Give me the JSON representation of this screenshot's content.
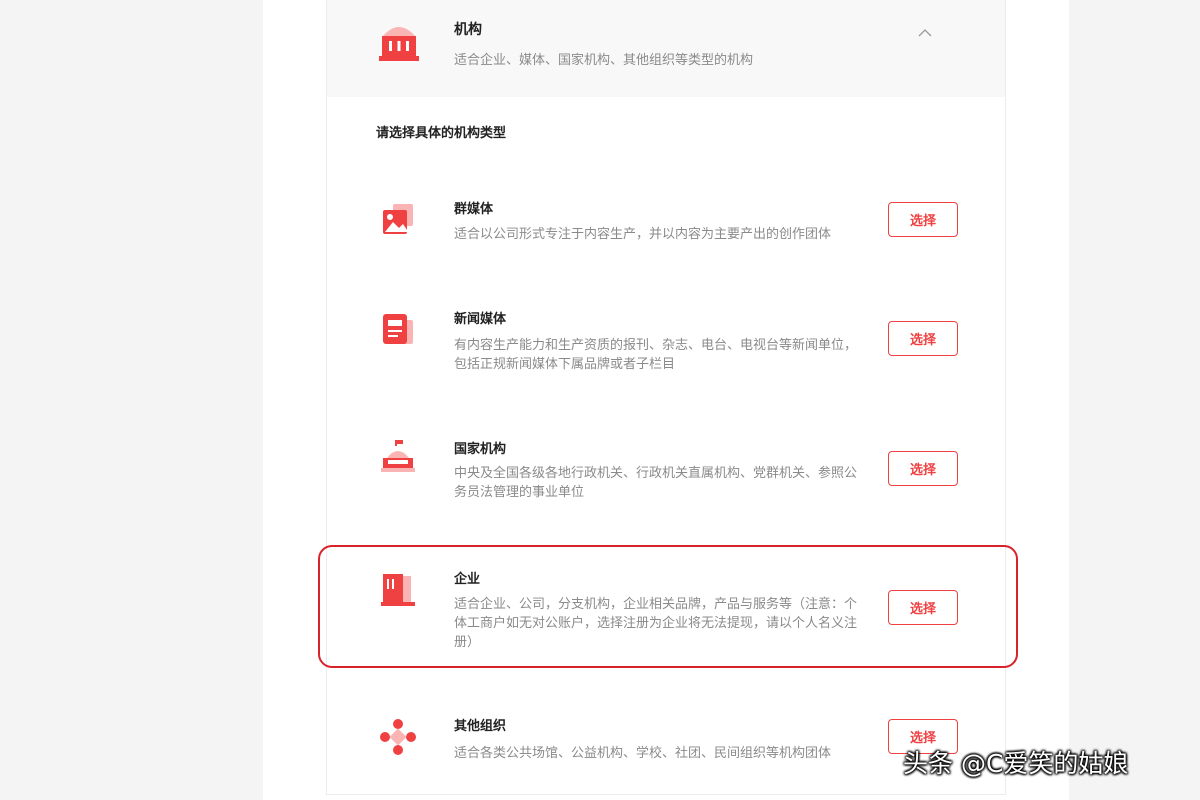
{
  "colors": {
    "accent": "#f04142",
    "icon_light": "#fbb4b4",
    "highlight": "#d9232a"
  },
  "org": {
    "title": "机构",
    "description": "适合企业、媒体、国家机构、其他组织等类型的机构",
    "icon": "institution-building-icon",
    "toggle_icon": "chevron-up-icon"
  },
  "section_hint": "请选择具体的机构类型",
  "items": [
    {
      "title": "群媒体",
      "description": "适合以公司形式专注于内容生产，并以内容为主要产出的创作团体",
      "button": "选择",
      "icon": "image-gallery-icon"
    },
    {
      "title": "新闻媒体",
      "description": "有内容生产能力和生产资质的报刊、杂志、电台、电视台等新闻单位，包括正规新闻媒体下属品牌或者子栏目",
      "button": "选择",
      "icon": "newspaper-icon"
    },
    {
      "title": "国家机构",
      "description": "中央及全国各级各地行政机关、行政机关直属机构、党群机关、参照公务员法管理的事业单位",
      "button": "选择",
      "icon": "government-building-icon"
    },
    {
      "title": "企业",
      "description": "适合企业、公司，分支机构，企业相关品牌，产品与服务等（注意：个体工商户如无对公账户，选择注册为企业将无法提现，请以个人名义注册）",
      "button": "选择",
      "icon": "office-building-icon"
    },
    {
      "title": "其他组织",
      "description": "适合各类公共场馆、公益机构、学校、社团、民间组织等机构团体",
      "button": "选择",
      "icon": "organization-dots-icon"
    }
  ],
  "watermark": "头条 @C爱笑的姑娘"
}
